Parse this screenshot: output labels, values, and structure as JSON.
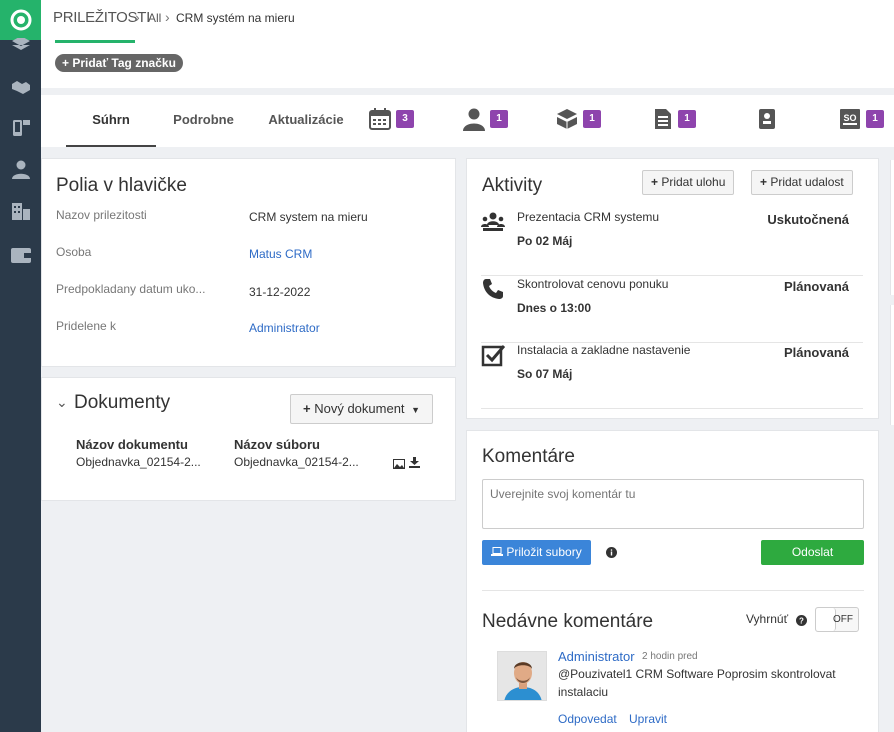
{
  "breadcrumb": {
    "title": "PRILEŽITOSTI",
    "all": "All",
    "current": "CRM systém na mieru"
  },
  "tag_button": "+ Pridať Tag značku",
  "tabs": [
    {
      "label": "Súhrn"
    },
    {
      "label": "Podrobne"
    },
    {
      "label": "Aktualizácie"
    }
  ],
  "tab_icons": [
    {
      "icon": "calendar-icon",
      "count": "3"
    },
    {
      "icon": "person-icon",
      "count": "1"
    },
    {
      "icon": "boxes-icon",
      "count": "1"
    },
    {
      "icon": "document-icon",
      "count": "1"
    },
    {
      "icon": "contact-book-icon",
      "count": ""
    },
    {
      "icon": "sales-order-icon",
      "count": "1"
    }
  ],
  "header_fields": {
    "title": "Polia v hlavičke",
    "rows": [
      {
        "label": "Nazov prilezitosti",
        "value": "CRM system na mieru"
      },
      {
        "label": "Osoba",
        "value": "Matus CRM"
      },
      {
        "label": "Predpokladany datum uko...",
        "value": "31-12-2022"
      },
      {
        "label": "Pridelene k",
        "value": "Administrator"
      }
    ]
  },
  "documents": {
    "title": "Dokumenty",
    "new_button": "Nový dokument",
    "col_name": "Názov dokumentu",
    "col_file": "Názov súboru",
    "rows": [
      {
        "name": "Objednavka_02154-2...",
        "file": "Objednavka_02154-2..."
      }
    ]
  },
  "activities": {
    "title": "Aktivity",
    "add_task": "Pridat ulohu",
    "add_event": "Pridat udalost",
    "items": [
      {
        "icon": "meeting-icon",
        "title": "Prezentacia CRM systemu",
        "date": "Po 02 Máj",
        "status": "Uskutočnená"
      },
      {
        "icon": "phone-icon",
        "title": "Skontrolovat cenovu ponuku",
        "date": "Dnes o 13:00",
        "status": "Plánovaná"
      },
      {
        "icon": "checkbox-icon",
        "title": "Instalacia a zakladne nastavenie",
        "date": "So 07 Máj",
        "status": "Plánovaná"
      }
    ]
  },
  "comments": {
    "title": "Komentáre",
    "placeholder": "Uverejnite svoj komentár tu",
    "attach_label": "Priložit subory",
    "send_label": "Odoslat",
    "recent_title": "Nedávne komentáre",
    "rollup_label": "Vyhrnúť",
    "toggle_state": "OFF",
    "entry": {
      "author": "Administrator",
      "time": "2 hodin pred",
      "text": "@Pouzivatel1 CRM Software Poprosim skontrolovat instalaciu",
      "reply": "Odpovedat",
      "edit": "Upravit"
    }
  }
}
